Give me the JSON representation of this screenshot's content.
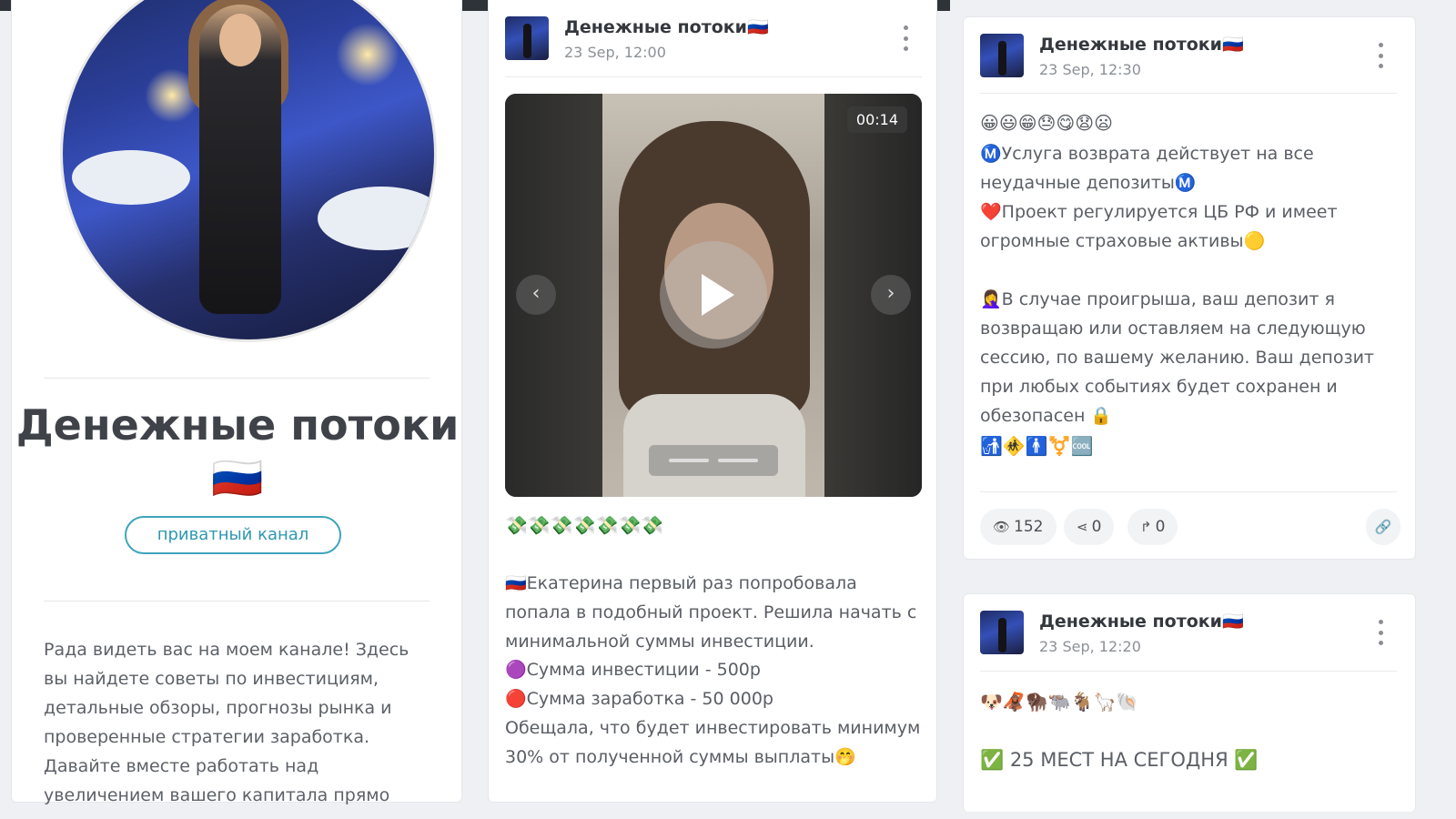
{
  "profile": {
    "name": "Денежные потоки🇷🇺",
    "badge": "приватный канал",
    "description": "Рада видеть вас на моем канале! Здесь вы найдете советы по инвестициям, детальные обзоры, прогнозы рынка и проверенные стратегии заработка. Давайте вместе работать над увеличением вашего капитала прямо"
  },
  "post_mid": {
    "title": "Денежные потоки🇷🇺",
    "date": "23 Sep, 12:00",
    "video_duration": "00:14",
    "emoji_line": "💸💸💸💸💸💸💸",
    "line1": "🇷🇺Екатерина первый раз попробовала попала в подобный проект. Решила начать с минимальной суммы инвестиции.",
    "line2": "🟣Сумма инвестиции - 500р",
    "line3": "🔴Сумма заработка - 50 000р",
    "line4": "Обещала, что будет инвестировать минимум 30% от полученной суммы выплаты🤭"
  },
  "post_r1": {
    "title": "Денежные потоки🇷🇺",
    "date": "23 Sep, 12:30",
    "emoji_line": "😀😃😁😓😋😧😦",
    "bold1": "Ⓜ️Услуга возврата действует на все неудачные депозитыⓂ️",
    "bold2": "❤️Проект регулируется ЦБ РФ и имеет огромные страховые активы🟡",
    "text": "🤦‍♀️В случае проигрыша, ваш депозит я возвращаю или оставляем на следующую сессию, по вашему желанию. Ваш депозит при любых событиях будет сохранен и обезопасен 🔒",
    "symbols": "🚮🚸🚹⚧️🆒",
    "views": "152",
    "shares": "0",
    "forwards": "0"
  },
  "post_r2": {
    "title": "Денежные потоки🇷🇺",
    "date": "23 Sep, 12:20",
    "emoji_line": "🐶🦧🦬🐃🐐🦙🐚",
    "headline": "✅ 25 МЕСТ НА СЕГОДНЯ ✅"
  }
}
